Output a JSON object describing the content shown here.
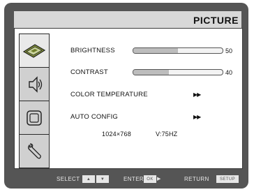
{
  "menu": {
    "title": "PICTURE"
  },
  "sidebar": {
    "items": [
      {
        "icon": "picture-icon"
      },
      {
        "icon": "audio-icon"
      },
      {
        "icon": "screen-icon"
      },
      {
        "icon": "setup-wrench-icon"
      }
    ]
  },
  "settings": {
    "brightness": {
      "label": "BRIGHTNESS",
      "value": "50",
      "level": 0.5
    },
    "contrast": {
      "label": "CONTRAST",
      "value": "40",
      "level": 0.4
    },
    "color_temperature": {
      "label": "COLOR TEMPERATURE",
      "arrows": "▶▶"
    },
    "auto_config": {
      "label": "AUTO CONFIG",
      "arrows": "▶▶"
    }
  },
  "status": {
    "resolution": "1024×768",
    "refresh": "V:75HZ"
  },
  "footer": {
    "select_label": "SELECT",
    "up_key": "▲",
    "down_key": "▼",
    "enter_label": "ENTER",
    "ok_key": "OK",
    "enter_arrow": "▶",
    "return_label": "RETURN",
    "setup_key": "SETUP"
  },
  "colors": {
    "frame": "#555555",
    "panel": "#ffffff",
    "sidebar": "#d0d0d0",
    "slider_fill": "#bdbdbd"
  }
}
